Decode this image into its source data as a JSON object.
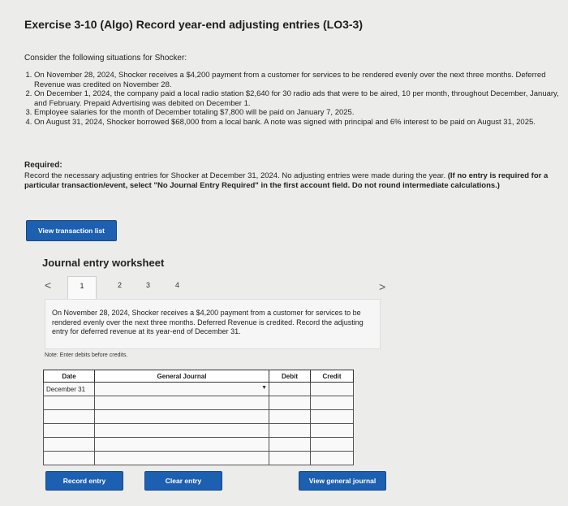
{
  "title": "Exercise 3-10 (Algo) Record year-end adjusting entries (LO3-3)",
  "intro": "Consider the following situations for Shocker:",
  "situations": [
    "On November 28, 2024, Shocker receives a $4,200 payment from a customer for services to be rendered evenly over the next three months. Deferred Revenue was credited on November 28.",
    "On December 1, 2024, the company paid a local radio station $2,640 for 30 radio ads that were to be aired, 10 per month, throughout December, January, and February. Prepaid Advertising was debited on December 1.",
    "Employee salaries for the month of December totaling $7,800 will be paid on January 7, 2025.",
    "On August 31, 2024, Shocker borrowed $68,000 from a local bank. A note was signed with principal and 6% interest to be paid on August 31, 2025."
  ],
  "required": {
    "heading": "Required:",
    "text": "Record the necessary adjusting entries for Shocker at December 31, 2024. No adjusting entries were made during the year.",
    "bold_text": "(If no entry is required for a particular transaction/event, select \"No Journal Entry Required\" in the first account field. Do not round intermediate calculations.)"
  },
  "buttons": {
    "view_transaction_list": "View transaction list",
    "record_entry": "Record entry",
    "clear_entry": "Clear entry",
    "view_general_journal": "View general journal"
  },
  "worksheet": {
    "title": "Journal entry worksheet",
    "prev": "<",
    "next": ">",
    "tabs": [
      "1",
      "2",
      "3",
      "4"
    ],
    "active_tab": "1",
    "description": "On November 28, 2024, Shocker receives a $4,200 payment from a customer for services to be rendered evenly over the next three months. Deferred Revenue is credited. Record the adjusting entry for deferred revenue at its year-end of December 31.",
    "note": "Note: Enter debits before credits."
  },
  "journal": {
    "headers": {
      "date": "Date",
      "account": "General Journal",
      "debit": "Debit",
      "credit": "Credit"
    },
    "rows": [
      {
        "date": "December 31",
        "account": "",
        "debit": "",
        "credit": ""
      },
      {
        "date": "",
        "account": "",
        "debit": "",
        "credit": ""
      },
      {
        "date": "",
        "account": "",
        "debit": "",
        "credit": ""
      },
      {
        "date": "",
        "account": "",
        "debit": "",
        "credit": ""
      },
      {
        "date": "",
        "account": "",
        "debit": "",
        "credit": ""
      },
      {
        "date": "",
        "account": "",
        "debit": "",
        "credit": ""
      }
    ]
  },
  "colors": {
    "button": "#1d5fb0",
    "background": "#ececea"
  }
}
